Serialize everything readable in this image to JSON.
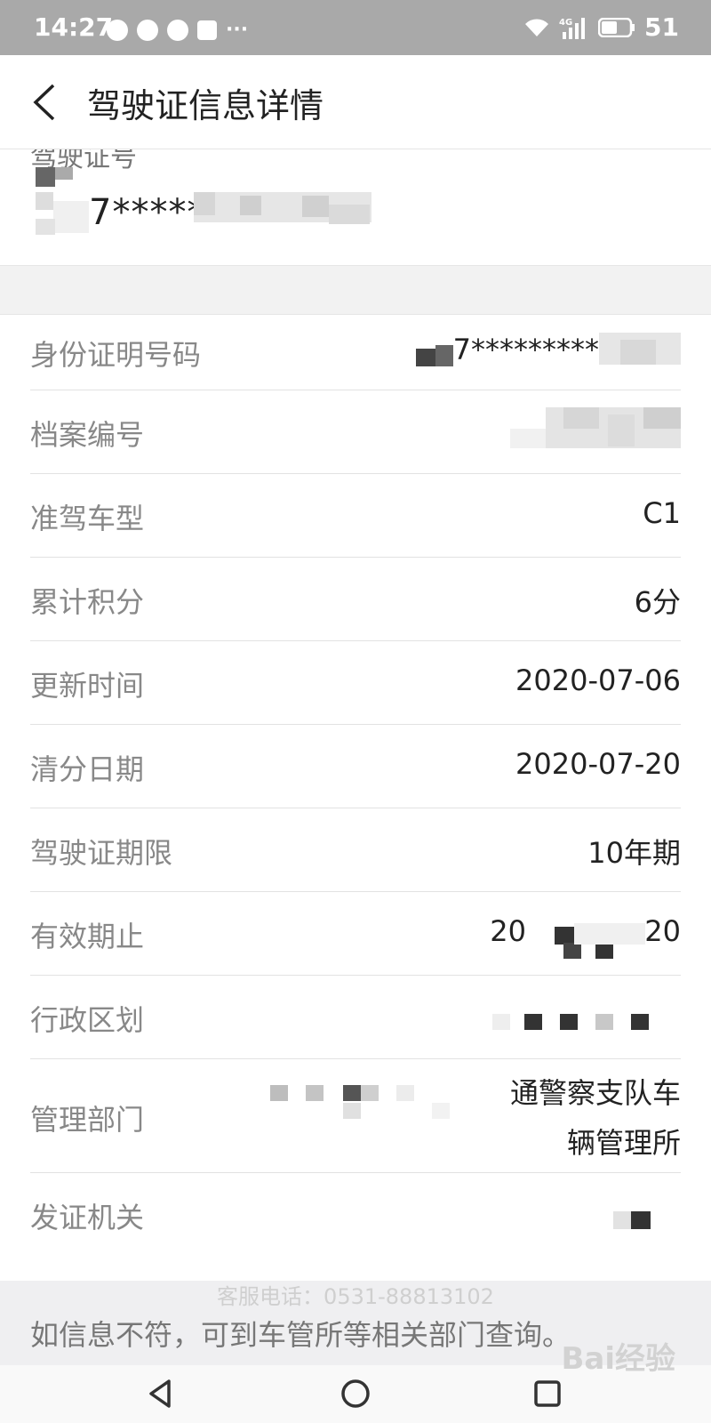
{
  "status_bar": {
    "time": "14:27",
    "network": "4G",
    "battery": "51"
  },
  "header": {
    "title": "驾驶证信息详情"
  },
  "license": {
    "label": "驾驶证号",
    "value": "7*****"
  },
  "rows": [
    {
      "label": "身份证明号码",
      "value": "7*********"
    },
    {
      "label": "档案编号",
      "value": ""
    },
    {
      "label": "准驾车型",
      "value": "C1"
    },
    {
      "label": "累计积分",
      "value": "6分"
    },
    {
      "label": "更新时间",
      "value": "2020-07-06"
    },
    {
      "label": "清分日期",
      "value": "2020-07-20"
    },
    {
      "label": "驾驶证期限",
      "value": "10年期"
    },
    {
      "label": "有效期止",
      "value_start": "20",
      "value_end": "20"
    },
    {
      "label": "行政区划",
      "value": ""
    },
    {
      "label": "管理部门",
      "value_line1": "通警察支队车",
      "value_line2": "辆管理所"
    },
    {
      "label": "发证机关",
      "value": ""
    }
  ],
  "footer": {
    "service_phone": "客服电话：0531-88813102",
    "notice": "如信息不符，可到车管所等相关部门查询。"
  },
  "watermark": "Bai经验"
}
